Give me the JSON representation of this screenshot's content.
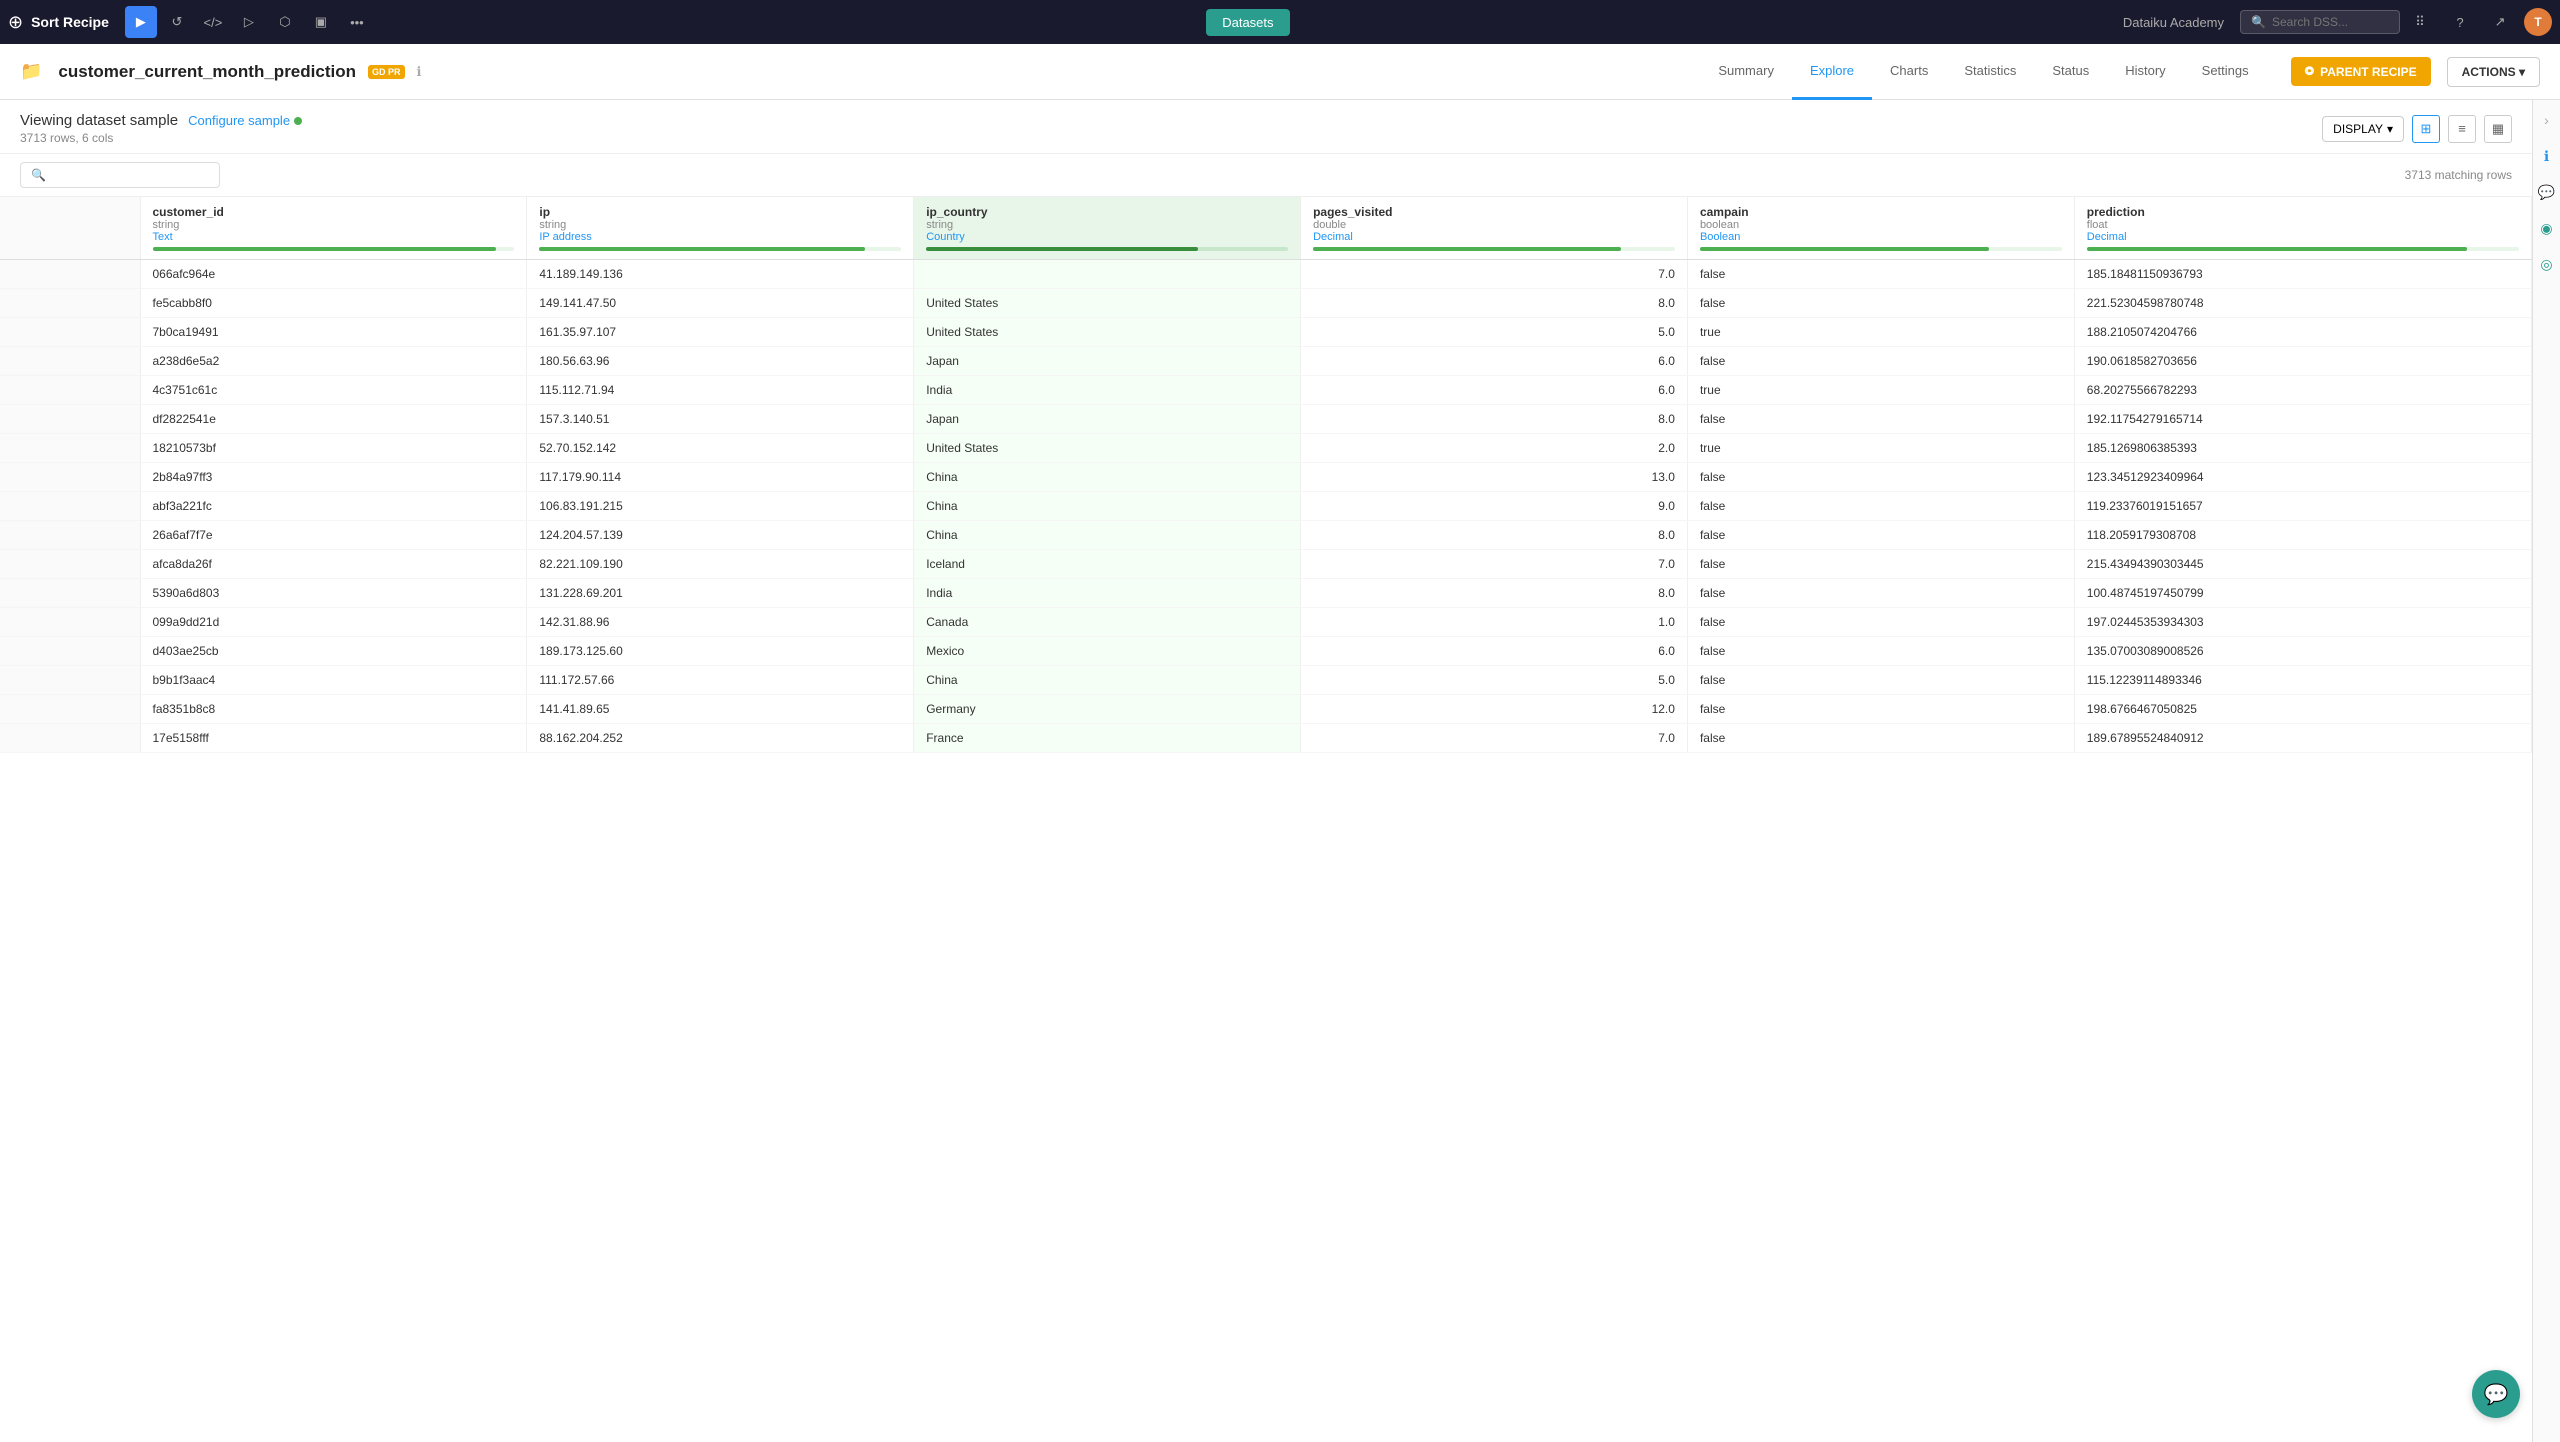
{
  "topNav": {
    "appTitle": "Sort Recipe",
    "datasetsLabel": "Datasets",
    "dataikuAcademy": "Dataiku Academy",
    "searchPlaceholder": "Search DSS...",
    "avatarInitial": "T"
  },
  "datasetHeader": {
    "datasetName": "customer_current_month_prediction",
    "gdprBadge": "GD PR",
    "tabs": [
      {
        "id": "summary",
        "label": "Summary"
      },
      {
        "id": "explore",
        "label": "Explore"
      },
      {
        "id": "charts",
        "label": "Charts"
      },
      {
        "id": "statistics",
        "label": "Statistics"
      },
      {
        "id": "status",
        "label": "Status"
      },
      {
        "id": "history",
        "label": "History"
      },
      {
        "id": "settings",
        "label": "Settings"
      }
    ],
    "activeTab": "explore",
    "parentRecipeBtn": "PARENT RECIPE",
    "actionsBtn": "ACTIONS"
  },
  "viewingHeader": {
    "title": "Viewing dataset sample",
    "configureSample": "Configure sample",
    "rowCount": "3713 rows,  6 cols",
    "displayBtn": "DISPLAY",
    "matchingRows": "3713 matching rows"
  },
  "columns": [
    {
      "id": "customer_id",
      "name": "customer_id",
      "type": "string",
      "meaning": "Text",
      "meaningClass": "meaning-text",
      "barWidth": "95"
    },
    {
      "id": "ip",
      "name": "ip",
      "type": "string",
      "meaning": "IP address",
      "meaningClass": "meaning-ip",
      "barWidth": "90"
    },
    {
      "id": "ip_country",
      "name": "ip_country",
      "type": "string",
      "meaning": "Country",
      "meaningClass": "meaning-country",
      "barWidth": "75",
      "highlighted": true
    },
    {
      "id": "pages_visited",
      "name": "pages_visited",
      "type": "double",
      "meaning": "Decimal",
      "meaningClass": "meaning-decimal",
      "barWidth": "85"
    },
    {
      "id": "campain",
      "name": "campain",
      "type": "boolean",
      "meaning": "Boolean",
      "meaningClass": "meaning-boolean",
      "barWidth": "80"
    },
    {
      "id": "prediction",
      "name": "prediction",
      "type": "float",
      "meaning": "Decimal",
      "meaningClass": "meaning-decimal",
      "barWidth": "88"
    }
  ],
  "rows": [
    {
      "customer_id": "066afc964e",
      "ip": "41.189.149.136",
      "ip_country": "",
      "pages_visited": "7.0",
      "campain": "false",
      "prediction": "185.18481150936793"
    },
    {
      "customer_id": "fe5cabb8f0",
      "ip": "149.141.47.50",
      "ip_country": "United States",
      "pages_visited": "8.0",
      "campain": "false",
      "prediction": "221.52304598780748"
    },
    {
      "customer_id": "7b0ca19491",
      "ip": "161.35.97.107",
      "ip_country": "United States",
      "pages_visited": "5.0",
      "campain": "true",
      "prediction": "188.2105074204766"
    },
    {
      "customer_id": "a238d6e5a2",
      "ip": "180.56.63.96",
      "ip_country": "Japan",
      "pages_visited": "6.0",
      "campain": "false",
      "prediction": "190.0618582703656"
    },
    {
      "customer_id": "4c3751c61c",
      "ip": "115.112.71.94",
      "ip_country": "India",
      "pages_visited": "6.0",
      "campain": "true",
      "prediction": "68.20275566782293"
    },
    {
      "customer_id": "df2822541e",
      "ip": "157.3.140.51",
      "ip_country": "Japan",
      "pages_visited": "8.0",
      "campain": "false",
      "prediction": "192.11754279165714"
    },
    {
      "customer_id": "18210573bf",
      "ip": "52.70.152.142",
      "ip_country": "United States",
      "pages_visited": "2.0",
      "campain": "true",
      "prediction": "185.1269806385393"
    },
    {
      "customer_id": "2b84a97ff3",
      "ip": "117.179.90.114",
      "ip_country": "China",
      "pages_visited": "13.0",
      "campain": "false",
      "prediction": "123.34512923409964"
    },
    {
      "customer_id": "abf3a221fc",
      "ip": "106.83.191.215",
      "ip_country": "China",
      "pages_visited": "9.0",
      "campain": "false",
      "prediction": "119.23376019151657"
    },
    {
      "customer_id": "26a6af7f7e",
      "ip": "124.204.57.139",
      "ip_country": "China",
      "pages_visited": "8.0",
      "campain": "false",
      "prediction": "118.2059179308708"
    },
    {
      "customer_id": "afca8da26f",
      "ip": "82.221.109.190",
      "ip_country": "Iceland",
      "pages_visited": "7.0",
      "campain": "false",
      "prediction": "215.43494390303445"
    },
    {
      "customer_id": "5390a6d803",
      "ip": "131.228.69.201",
      "ip_country": "India",
      "pages_visited": "8.0",
      "campain": "false",
      "prediction": "100.48745197450799"
    },
    {
      "customer_id": "099a9dd21d",
      "ip": "142.31.88.96",
      "ip_country": "Canada",
      "pages_visited": "1.0",
      "campain": "false",
      "prediction": "197.02445353934303"
    },
    {
      "customer_id": "d403ae25cb",
      "ip": "189.173.125.60",
      "ip_country": "Mexico",
      "pages_visited": "6.0",
      "campain": "false",
      "prediction": "135.07003089008526"
    },
    {
      "customer_id": "b9b1f3aac4",
      "ip": "111.172.57.66",
      "ip_country": "China",
      "pages_visited": "5.0",
      "campain": "false",
      "prediction": "115.12239114893346"
    },
    {
      "customer_id": "fa8351b8c8",
      "ip": "141.41.89.65",
      "ip_country": "Germany",
      "pages_visited": "12.0",
      "campain": "false",
      "prediction": "198.6766467050825"
    },
    {
      "customer_id": "17e5158fff",
      "ip": "88.162.204.252",
      "ip_country": "France",
      "pages_visited": "7.0",
      "campain": "false",
      "prediction": "189.67895524840912"
    }
  ]
}
